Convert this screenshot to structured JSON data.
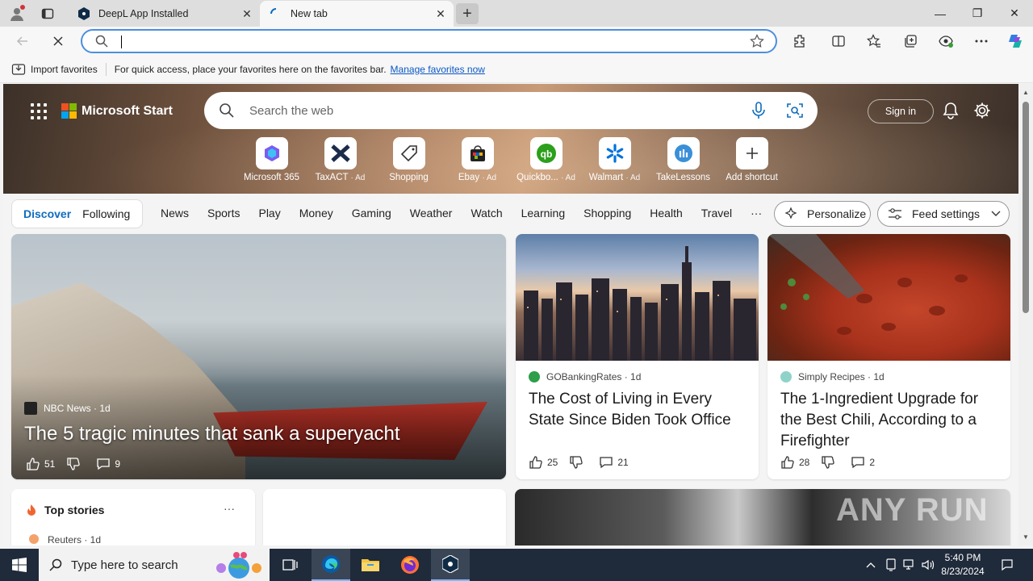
{
  "browser": {
    "tabs": [
      {
        "label": "DeepL App Installed"
      },
      {
        "label": "New tab"
      }
    ],
    "window_controls": {
      "minimize": "—",
      "restore": "❐",
      "close": "✕"
    },
    "favorites_bar": {
      "import_label": "Import favorites",
      "message": "For quick access, place your favorites here on the favorites bar.",
      "manage_link": "Manage favorites now"
    }
  },
  "page": {
    "brand": "Microsoft Start",
    "search_placeholder": "Search the web",
    "sign_in": "Sign in",
    "shortcuts": [
      {
        "label": "Microsoft 365",
        "ad": ""
      },
      {
        "label": "TaxACT",
        "ad": "· Ad"
      },
      {
        "label": "Shopping",
        "ad": ""
      },
      {
        "label": "Ebay",
        "ad": "· Ad"
      },
      {
        "label": "Quickbo...",
        "ad": "· Ad"
      },
      {
        "label": "Walmart",
        "ad": "· Ad"
      },
      {
        "label": "TakeLessons",
        "ad": ""
      },
      {
        "label": "Add shortcut",
        "ad": ""
      }
    ],
    "feed_tabs": {
      "discover": "Discover",
      "following": "Following"
    },
    "nav_links": [
      "News",
      "Sports",
      "Play",
      "Money",
      "Gaming",
      "Weather",
      "Watch",
      "Learning",
      "Shopping",
      "Health",
      "Travel",
      "···"
    ],
    "personalize": "Personalize",
    "feed_settings": "Feed settings",
    "cards": {
      "main": {
        "source": "NBC News · 1d",
        "headline": "The 5 tragic minutes that sank a superyacht",
        "likes": "51",
        "comments": "9"
      },
      "card2": {
        "source": "GOBankingRates · 1d",
        "title": "The Cost of Living in Every State Since Biden Took Office",
        "likes": "25",
        "comments": "21"
      },
      "card3": {
        "source": "Simply Recipes · 1d",
        "title": "The 1-Ingredient Upgrade for the Best Chili, According to a Firefighter",
        "likes": "28",
        "comments": "2"
      },
      "top_stories": {
        "title": "Top stories",
        "more": "···",
        "first_source": "Reuters · 1d"
      }
    },
    "watermark": "ANY RUN"
  },
  "taskbar": {
    "search_placeholder": "Type here to search",
    "time": "5:40 PM",
    "date": "8/23/2024"
  },
  "colors": {
    "accent": "#0f6cbd",
    "taskbar": "#1f2a3a",
    "omnibox_border": "#4c8fde"
  }
}
